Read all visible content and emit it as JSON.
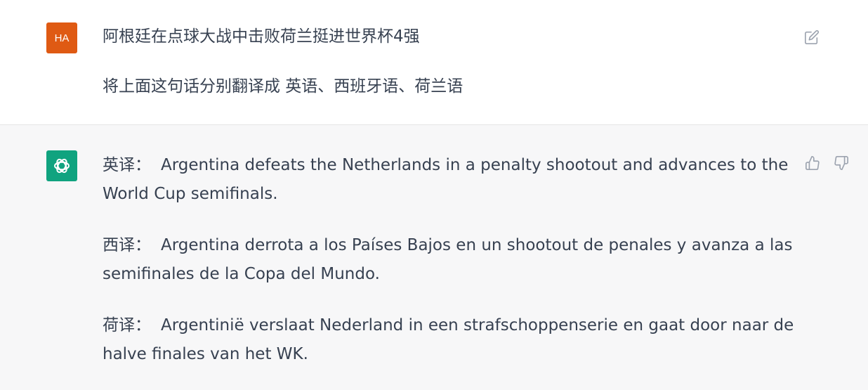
{
  "user": {
    "avatar_text": "HA",
    "message_line1": "阿根廷在点球大战中击败荷兰挺进世界杯4强",
    "message_line2": "将上面这句话分别翻译成 英语、西班牙语、荷兰语"
  },
  "assistant": {
    "paragraphs": [
      {
        "label": "英译：",
        "text": "Argentina defeats the Netherlands in a penalty shootout and advances to the World Cup semifinals."
      },
      {
        "label": "西译：",
        "text": "Argentina derrota a los Países Bajos en un shootout de penales y avanza a las semifinales de la Copa del Mundo."
      },
      {
        "label": "荷译：",
        "text": "Argentinië verslaat Nederland in een strafschoppenserie en gaat door naar de halve finales van het WK."
      }
    ]
  },
  "icons": {
    "edit": "edit-icon",
    "thumbs_up": "thumbs-up-icon",
    "thumbs_down": "thumbs-down-icon",
    "assistant_logo": "openai-logo-icon"
  },
  "colors": {
    "user_avatar": "#df5a13",
    "assistant_avatar": "#10a37f",
    "assistant_bg": "#f7f7f8",
    "text": "#374151",
    "icon": "#9ca3af"
  }
}
